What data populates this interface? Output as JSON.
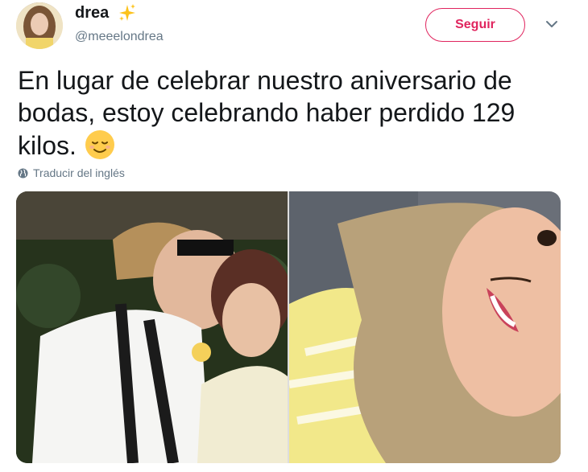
{
  "author": {
    "display_name": "drea",
    "handle": "@meeelondrea",
    "name_emoji": "sparkles"
  },
  "follow": {
    "label": "Seguir"
  },
  "menu": {
    "icon": "chevron-down-icon"
  },
  "tweet": {
    "text": "En lugar de celebrar nuestro aniversario de bodas, estoy celebrando haber perdido 129 kilos.",
    "emoji": "relieved-face"
  },
  "translate": {
    "label": "Traducir del inglés",
    "icon": "globe-icon"
  },
  "media": {
    "photos": [
      {
        "description": "couple-wedding-photo"
      },
      {
        "description": "smiling-selfie"
      }
    ]
  },
  "colors": {
    "accent": "#e0245e",
    "text": "#14171a",
    "secondary": "#657786"
  }
}
